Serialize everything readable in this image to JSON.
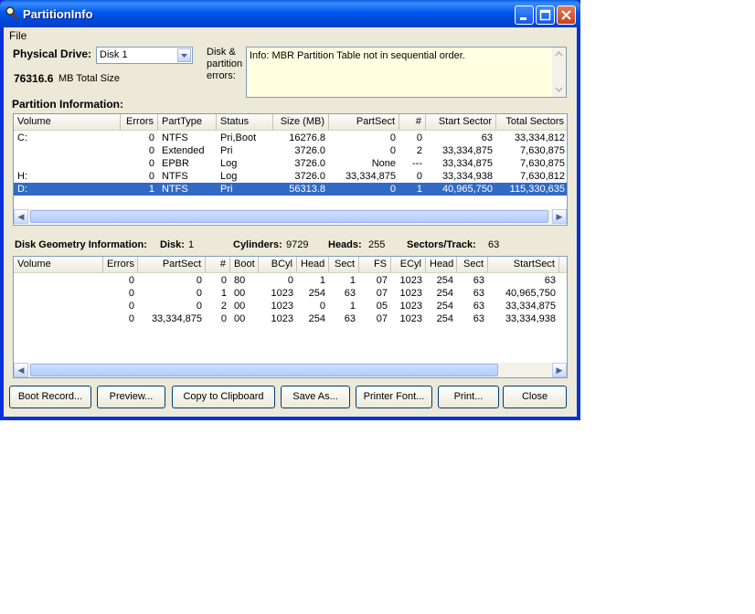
{
  "window": {
    "title": "PartitionInfo"
  },
  "menu": {
    "file": "File"
  },
  "physical_drive": {
    "label": "Physical Drive:",
    "value": "Disk 1",
    "total_size_value": "76316.6",
    "total_size_suffix": "MB Total Size"
  },
  "errors": {
    "label_1": "Disk &",
    "label_2": "partition",
    "label_3": "errors:",
    "text": "Info: MBR Partition Table not in sequential order."
  },
  "partition_info": {
    "heading": "Partition Information:",
    "columns": [
      "Volume",
      "Errors",
      "PartType",
      "Status",
      "Size (MB)",
      "PartSect",
      "#",
      "Start Sector",
      "Total Sectors"
    ],
    "rows": [
      [
        "C:",
        "0",
        "NTFS",
        "Pri,Boot",
        "16276.8",
        "0",
        "0",
        "63",
        "33,334,812"
      ],
      [
        "",
        "0",
        "Extended",
        "Pri",
        "3726.0",
        "0",
        "2",
        "33,334,875",
        "7,630,875"
      ],
      [
        "",
        "0",
        "EPBR",
        "Log",
        "3726.0",
        "None",
        "---",
        "33,334,875",
        "7,630,875"
      ],
      [
        "H:",
        "0",
        "NTFS",
        "Log",
        "3726.0",
        "33,334,875",
        "0",
        "33,334,938",
        "7,630,812"
      ],
      [
        "D:",
        "1",
        "NTFS",
        "Pri",
        "56313.8",
        "0",
        "1",
        "40,965,750",
        "115,330,635"
      ]
    ]
  },
  "geometry": {
    "heading": "Disk Geometry Information:",
    "disk_label": "Disk:",
    "disk_value": "1",
    "cyl_label": "Cylinders:",
    "cyl_value": "9729",
    "heads_label": "Heads:",
    "heads_value": "255",
    "spt_label": "Sectors/Track:",
    "spt_value": "63",
    "columns": [
      "Volume",
      "Errors",
      "PartSect",
      "#",
      "Boot",
      "BCyl",
      "Head",
      "Sect",
      "FS",
      "ECyl",
      "Head",
      "Sect",
      "StartSect"
    ],
    "rows": [
      [
        "",
        "0",
        "0",
        "0",
        "80",
        "0",
        "1",
        "1",
        "07",
        "1023",
        "254",
        "63",
        "63"
      ],
      [
        "",
        "0",
        "0",
        "1",
        "00",
        "1023",
        "254",
        "63",
        "07",
        "1023",
        "254",
        "63",
        "40,965,750"
      ],
      [
        "",
        "0",
        "0",
        "2",
        "00",
        "1023",
        "0",
        "1",
        "05",
        "1023",
        "254",
        "63",
        "33,334,875"
      ],
      [
        "",
        "0",
        "33,334,875",
        "0",
        "00",
        "1023",
        "254",
        "63",
        "07",
        "1023",
        "254",
        "63",
        "33,334,938"
      ]
    ]
  },
  "buttons": {
    "boot_record": "Boot Record...",
    "preview": "Preview...",
    "copy": "Copy to Clipboard",
    "save_as": "Save As...",
    "printer_font": "Printer Font...",
    "print": "Print...",
    "close": "Close"
  },
  "colors": {
    "selection": "#316ac5",
    "titlebar": "#0058ee",
    "face": "#ece9d8"
  }
}
